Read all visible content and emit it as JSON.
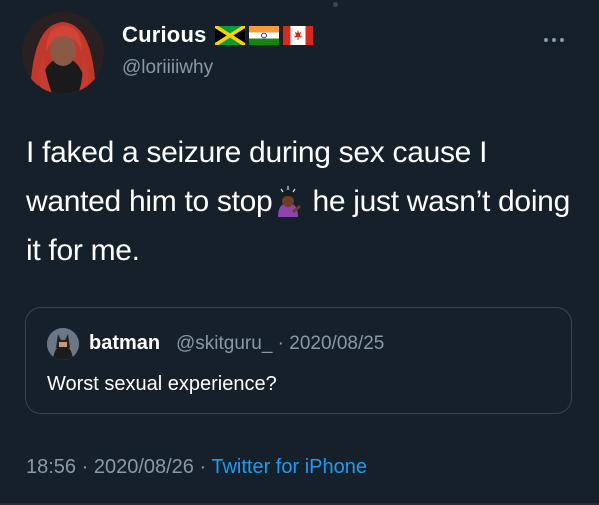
{
  "author": {
    "name": "Curious",
    "handle": "@loriiiiwhy",
    "flags": [
      "jamaica-flag-icon",
      "india-flag-icon",
      "canada-flag-icon"
    ]
  },
  "tweet": {
    "text_part1": "I faked a seizure during sex cause I wanted him to stop",
    "emoji": "person-tipping-hand-emoji",
    "text_part2": " he just wasn’t doing it for me."
  },
  "quote": {
    "name": "batman",
    "meta": "@skitguru_ · 2020/08/25",
    "text": "Worst sexual experience?"
  },
  "footer": {
    "time": "18:56 · 2020/08/26 · ",
    "source": "Twitter for iPhone"
  },
  "colors": {
    "background": "#15202b",
    "secondary_text": "#8b98a5",
    "link": "#1d9bf0",
    "border": "#38444d"
  }
}
